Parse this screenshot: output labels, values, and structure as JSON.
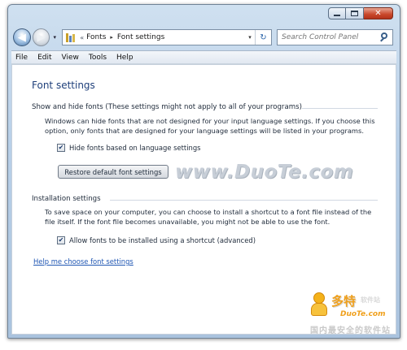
{
  "window": {
    "controls": {
      "minimize": "minimize",
      "maximize": "maximize",
      "close": "close"
    }
  },
  "nav": {
    "back_icon": "back-arrow-icon",
    "forward_icon": "forward-arrow-icon"
  },
  "address": {
    "separator": "«",
    "breadcrumbs": [
      "Fonts",
      "Font settings"
    ],
    "crumb_arrow": "▸",
    "dropdown": "▾",
    "refresh": "↻"
  },
  "search": {
    "placeholder": "Search Control Panel"
  },
  "menu": {
    "items": [
      "File",
      "Edit",
      "View",
      "Tools",
      "Help"
    ]
  },
  "page": {
    "title": "Font settings"
  },
  "show_hide": {
    "heading": "Show and hide fonts (These settings might not apply to all of your programs)",
    "description": "Windows can hide fonts that are not designed for your input language settings. If you choose this option, only fonts that are designed for your language settings will be listed in your programs.",
    "checkbox_label": "Hide fonts based on language settings",
    "checked": true,
    "restore_button": "Restore default font settings"
  },
  "installation": {
    "heading": "Installation settings",
    "description": "To save space on your computer, you can choose to install a shortcut to a font file instead of the file itself. If the font file becomes unavailable, you might not be able to use the font.",
    "checkbox_label": "Allow fonts to be installed using a shortcut (advanced)",
    "checked": true
  },
  "help_link": "Help me choose font settings",
  "watermark": "www.DuoTe.com",
  "badge": {
    "cn_title": "多特",
    "cn_small": "软件站",
    "en": "DuoTe.com",
    "tagline": "国内最安全的软件站"
  },
  "colors": {
    "accent": "#1f56b3",
    "title": "#1e3f7a",
    "close": "#c8462a",
    "chrome": "#b9d0e8"
  }
}
